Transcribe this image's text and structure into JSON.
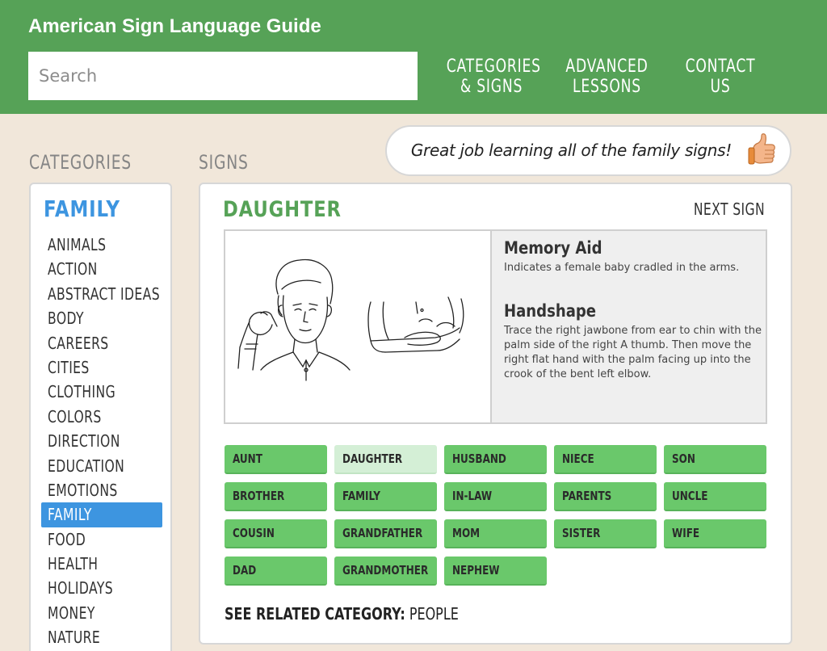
{
  "header": {
    "title": "American Sign Language Guide",
    "search_placeholder": "Search",
    "nav": [
      {
        "line1": "CATEGORIES",
        "line2": "& SIGNS"
      },
      {
        "line1": "ADVANCED",
        "line2": "LESSONS"
      },
      {
        "line1": "CONTACT",
        "line2": "US"
      }
    ]
  },
  "sections": {
    "categories_heading": "CATEGORIES",
    "signs_heading": "SIGNS"
  },
  "praise": {
    "text": "Great job learning all of the family signs!",
    "icon": "thumbs-up-icon"
  },
  "categories": {
    "current": "FAMILY",
    "items": [
      "ANIMALS",
      "ACTION",
      "ABSTRACT IDEAS",
      "BODY",
      "CAREERS",
      "CITIES",
      "CLOTHING",
      "COLORS",
      "DIRECTION",
      "EDUCATION",
      "EMOTIONS",
      "FAMILY",
      "FOOD",
      "HEALTH",
      "HOLIDAYS",
      "MONEY",
      "NATURE"
    ],
    "active_index": 11
  },
  "sign": {
    "name": "DAUGHTER",
    "next_label": "NEXT SIGN",
    "memory_aid_heading": "Memory Aid",
    "memory_aid_text": "Indicates a female baby cradled in the arms.",
    "handshape_heading": "Handshape",
    "handshape_text": "Trace the right jawbone from ear to chin with the palm side of the right A thumb. Then move the right flat hand with the palm facing up into the crook of the bent left elbow."
  },
  "sign_buttons": [
    "AUNT",
    "DAUGHTER",
    "HUSBAND",
    "NIECE",
    "SON",
    "BROTHER",
    "FAMILY",
    "IN-LAW",
    "PARENTS",
    "UNCLE",
    "COUSIN",
    "GRANDFATHER",
    "MOM",
    "SISTER",
    "WIFE",
    "DAD",
    "GRANDMOTHER",
    "NEPHEW"
  ],
  "current_sign_index": 1,
  "related": {
    "label": "SEE RELATED CATEGORY:",
    "link": "PEOPLE"
  },
  "colors": {
    "header_green": "#56a257",
    "background": "#f1e7da",
    "accent_blue": "#3d95e0",
    "button_green": "#6ac86b",
    "button_current": "#d4efd6"
  }
}
